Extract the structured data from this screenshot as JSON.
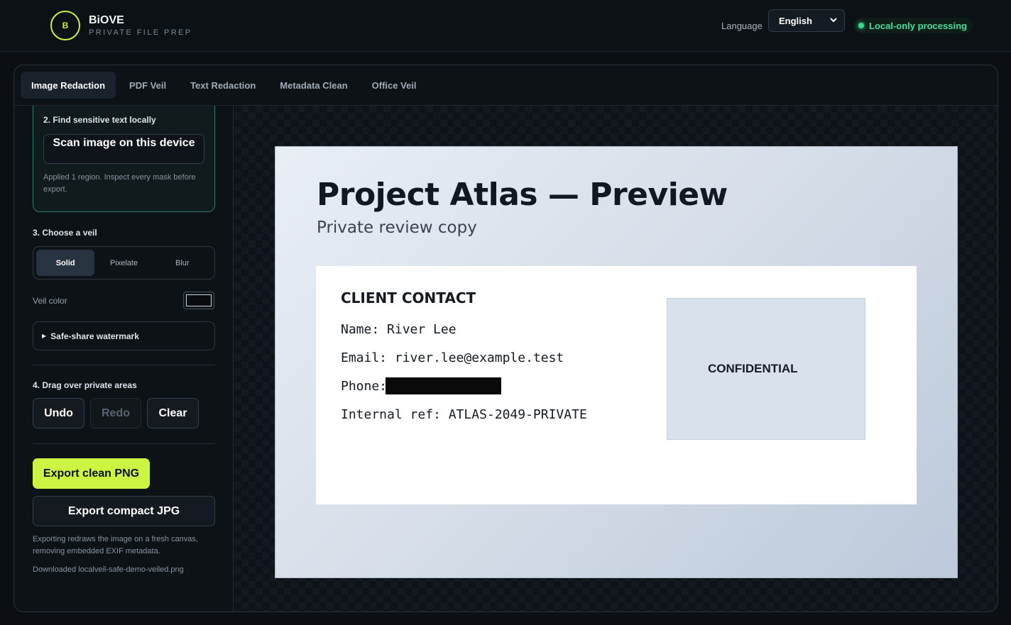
{
  "header": {
    "logo_letter": "B",
    "brand_name": "BiOVE",
    "brand_tagline": "PRIVATE FILE PREP",
    "language_label": "Language",
    "language_value": "English",
    "status_text": "Local-only processing",
    "status_color": "#35d98f"
  },
  "tabs": [
    {
      "label": "Image Redaction",
      "active": true
    },
    {
      "label": "PDF Veil",
      "active": false
    },
    {
      "label": "Text Redaction",
      "active": false
    },
    {
      "label": "Metadata Clean",
      "active": false
    },
    {
      "label": "Office Veil",
      "active": false
    }
  ],
  "sidebar": {
    "step2_title": "2. Find sensitive text locally",
    "scan_button": "Scan image on this device",
    "scan_note": "Applied 1 region. Inspect every mask before export.",
    "step3_title": "3. Choose a veil",
    "veil_options": [
      "Solid",
      "Pixelate",
      "Blur"
    ],
    "veil_selected": "Solid",
    "veil_color_label": "Veil color",
    "veil_color": "#0a0d10",
    "watermark_label": "Safe-share watermark",
    "step4_title": "4. Drag over private areas",
    "undo_label": "Undo",
    "redo_label": "Redo",
    "clear_label": "Clear",
    "export_png_label": "Export clean PNG",
    "export_jpg_label": "Export compact JPG",
    "export_note": "Exporting redraws the image on a fresh canvas, removing embedded EXIF metadata.",
    "download_note": "Downloaded localveil-safe-demo-veiled.png",
    "accent_color": "#cbf542"
  },
  "document": {
    "title": "Project Atlas — Preview",
    "subtitle": "Private review copy",
    "card_heading": "CLIENT CONTACT",
    "name_line": "Name: River Lee",
    "email_line": "Email: river.lee@example.test",
    "phone_label": "Phone:",
    "ref_line": "Internal ref: ATLAS-2049-PRIVATE",
    "stamp_text": "CONFIDENTIAL"
  }
}
